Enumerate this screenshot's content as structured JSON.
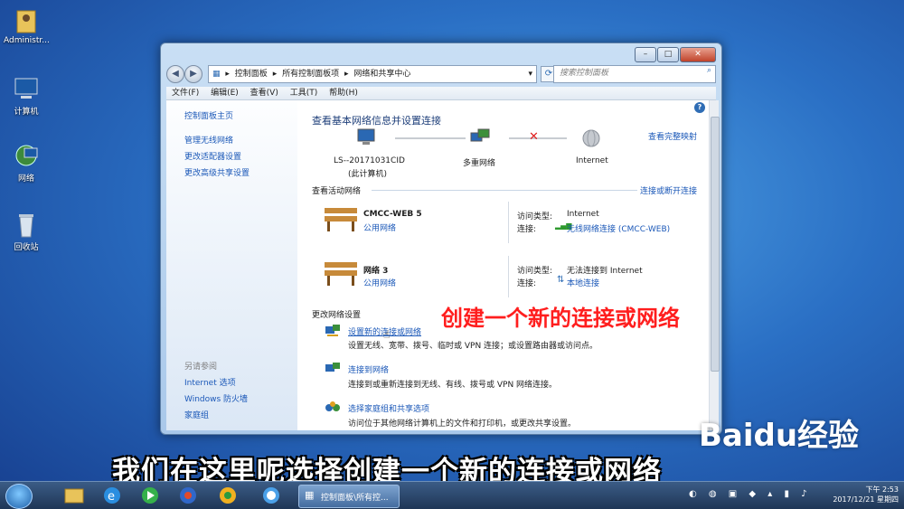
{
  "desktop": {
    "icons": [
      {
        "label": "Administr..."
      },
      {
        "label": "计算机"
      },
      {
        "label": "网络"
      },
      {
        "label": "回收站"
      }
    ]
  },
  "window": {
    "address": [
      "控制面板",
      "所有控制面板项",
      "网络和共享中心"
    ],
    "search_placeholder": "搜索控制面板",
    "menu": [
      "文件(F)",
      "编辑(E)",
      "查看(V)",
      "工具(T)",
      "帮助(H)"
    ],
    "left": {
      "home": "控制面板主页",
      "links": [
        "管理无线网络",
        "更改适配器设置",
        "更改高级共享设置"
      ],
      "see_also_title": "另请参阅",
      "see_also": [
        "Internet 选项",
        "Windows 防火墙",
        "家庭组"
      ]
    },
    "main": {
      "title": "查看基本网络信息并设置连接",
      "view_full_map": "查看完整映射",
      "map": {
        "computer_name": "LS--20171031CID",
        "computer_sub": "(此计算机)",
        "middle": "多重网络",
        "internet": "Internet"
      },
      "active_title": "查看活动网络",
      "connect_disconnect": "连接或断开连接",
      "networks": [
        {
          "name": "CMCC-WEB  5",
          "type": "公用网络",
          "access_label": "访问类型:",
          "access": "Internet",
          "conn_label": "连接:",
          "conn": "无线网络连接 (CMCC-WEB)"
        },
        {
          "name": "网络  3",
          "type": "公用网络",
          "access_label": "访问类型:",
          "access": "无法连接到 Internet",
          "conn_label": "连接:",
          "conn": "本地连接"
        }
      ],
      "change_title": "更改网络设置",
      "tasks": [
        {
          "title": "设置新的连接或网络",
          "desc": "设置无线、宽带、拨号、临时或 VPN 连接；或设置路由器或访问点。"
        },
        {
          "title": "连接到网络",
          "desc": "连接到或重新连接到无线、有线、拨号或 VPN 网络连接。"
        },
        {
          "title": "选择家庭组和共享选项",
          "desc": "访问位于其他网络计算机上的文件和打印机，或更改共享设置。"
        }
      ]
    }
  },
  "taskbar": {
    "task_label": "控制面板\\所有控...",
    "time": "下午 2:53",
    "date": "2017/12/21 星期四"
  },
  "annotation": "创建一个新的连接或网络",
  "subtitle": "我们在这里呢选择创建一个新的连接或网络",
  "watermark": "Baidu经验",
  "colors": {
    "link": "#1b58b8",
    "annotation": "#ff1e1e"
  }
}
